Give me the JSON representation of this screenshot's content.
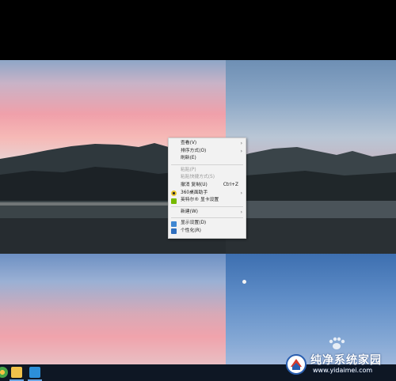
{
  "context_menu": {
    "items": [
      {
        "label": "查看(V)",
        "arrow": "›"
      },
      {
        "label": "排序方式(O)",
        "arrow": "›"
      },
      {
        "label": "刷新(E)"
      },
      {
        "label": "粘贴(P)",
        "disabled": true
      },
      {
        "label": "粘贴快捷方式(S)",
        "disabled": true
      },
      {
        "label": "撤消 复制(U)",
        "shortcut": "Ctrl+Z"
      },
      {
        "label": "360桌面助手",
        "arrow": "›",
        "icon": "360-icon"
      },
      {
        "label": "英特尔® 显卡设置",
        "icon": "intel-graphics-icon"
      },
      {
        "label": "新建(W)",
        "arrow": "›"
      },
      {
        "label": "显示设置(D)",
        "icon": "display-icon"
      },
      {
        "label": "个性化(R)",
        "icon": "personalize-icon"
      }
    ]
  },
  "taskbar": {
    "icons": [
      "chrome-icon",
      "folder-icon",
      "app-icon"
    ]
  },
  "watermark": {
    "title": "纯净系统家园",
    "url": "www.yidaimei.com"
  },
  "colors": {
    "taskbar": "#0e1724",
    "menu_bg": "#f2f2f2",
    "accent": "#6aa5e3"
  }
}
